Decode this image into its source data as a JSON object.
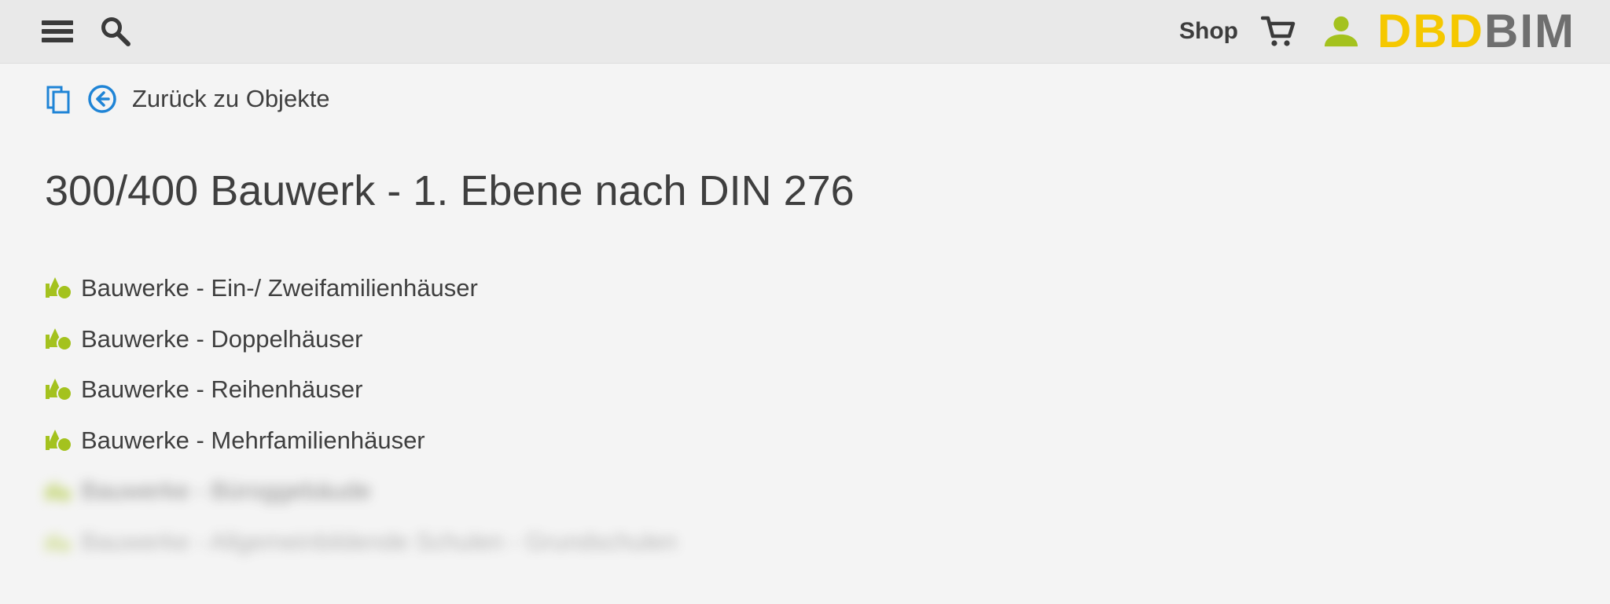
{
  "header": {
    "shop_label": "Shop",
    "logo": {
      "part1": "DBD",
      "part2": "BIM"
    },
    "colors": {
      "accent_green": "#a4c21e",
      "logo_yellow": "#f5c800",
      "logo_gray": "#6f6f6f",
      "link_blue": "#1f84d6"
    },
    "icons": [
      "menu-icon",
      "search-icon",
      "cart-icon",
      "user-icon"
    ]
  },
  "subnav": {
    "back_label": "Zurück zu Objekte",
    "icons": [
      "copy-icon",
      "arrow-left-circle-icon"
    ]
  },
  "page": {
    "title": "300/400 Bauwerk - 1. Ebene nach DIN 276"
  },
  "objects": [
    {
      "label": "Bauwerke - Ein-/ Zweifamilienhäuser"
    },
    {
      "label": "Bauwerke - Doppelhäuser"
    },
    {
      "label": "Bauwerke - Reihenhäuser"
    },
    {
      "label": "Bauwerke - Mehrfamilienhäuser"
    },
    {
      "label": "Bauwerke - Büroggebäude"
    },
    {
      "label": "Bauwerke - Allgemeinbildende Schulen - Grundschulen"
    }
  ]
}
